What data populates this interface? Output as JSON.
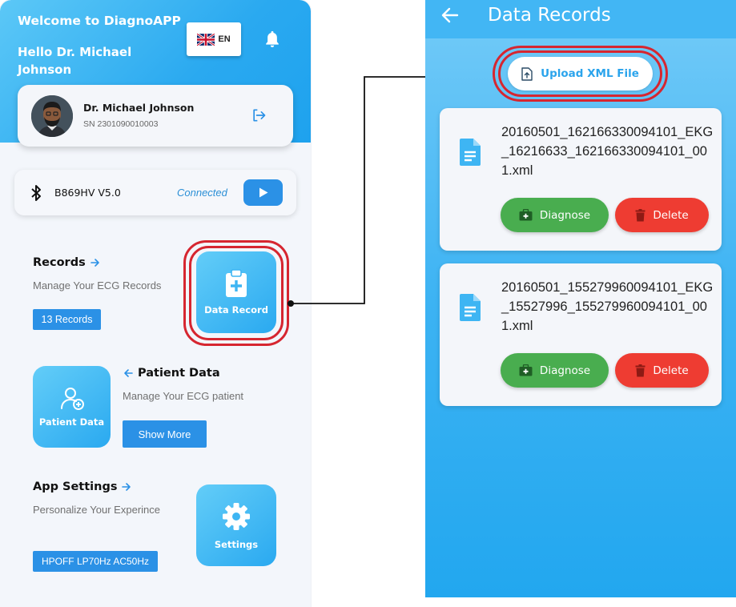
{
  "left": {
    "welcome": "Welcome to DiagnoAPP",
    "greeting": "Hello Dr. Michael Johnson",
    "language": "EN",
    "profile": {
      "name": "Dr. Michael Johnson",
      "sn": "SN 2301090010003"
    },
    "device": {
      "name": "B869HV V5.0",
      "status": "Connected"
    },
    "records": {
      "title": "Records",
      "description": "Manage Your ECG Records",
      "count_chip": "13 Records",
      "tile_label": "Data Record"
    },
    "patients": {
      "title": "Patient Data",
      "description": "Manage Your ECG patient",
      "button_label": "Show More",
      "tile_label": "Patient Data"
    },
    "settings": {
      "title": "App Settings",
      "description": "Personalize Your Experince",
      "filter_chip": "HPOFF LP70Hz AC50Hz",
      "tile_label": "Settings"
    }
  },
  "right": {
    "title": "Data Records",
    "upload_label": "Upload XML File",
    "files": [
      {
        "name": "20160501_162166330094101_EKG_16216633_162166330094101_001.xml",
        "diagnose_label": "Diagnose",
        "delete_label": "Delete"
      },
      {
        "name": "20160501_155279960094101_EKG_15527996_155279960094101_001.xml",
        "diagnose_label": "Diagnose",
        "delete_label": "Delete"
      }
    ]
  },
  "colors": {
    "primary_blue": "#2b91e6",
    "header_blue": "#2aa9f0",
    "diagnose_green": "#49ad4f",
    "delete_red": "#ee3c32",
    "highlight_ring": "#d62630"
  },
  "icons": [
    "uk-flag-icon",
    "bell-icon",
    "logout-icon",
    "bluetooth-icon",
    "play-icon",
    "arrow-right-icon",
    "clipboard-plus-icon",
    "user-add-icon",
    "arrow-left-icon",
    "gear-icon",
    "back-arrow-icon",
    "upload-file-icon",
    "document-icon",
    "medical-kit-icon",
    "trash-icon"
  ]
}
